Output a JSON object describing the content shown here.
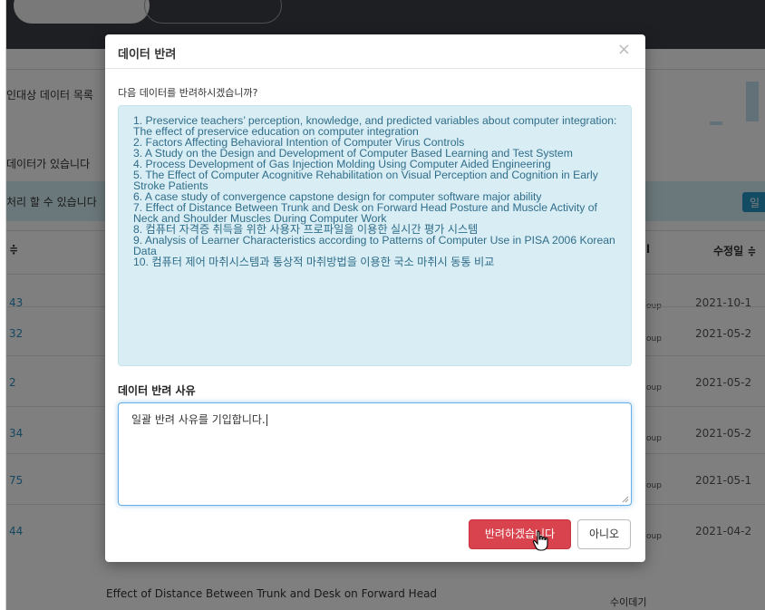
{
  "background": {
    "title_fragment": "인대상 데이터 목록",
    "notice_line1": "데이터가 있습니다",
    "notice_line2": "처리 할 수 있습니다",
    "button_fragment": "일",
    "col_head_left": "≑",
    "col_head_mid": "l",
    "col_head_right": "수정일 ≑",
    "rows": [
      {
        "id": "43",
        "group": "oup",
        "date": "2021-10-1"
      },
      {
        "id": "32",
        "group": "oup",
        "date": "2021-05-2"
      },
      {
        "id": "2",
        "group": "oup",
        "date": "2021-05-2"
      },
      {
        "id": "34",
        "group": "oup",
        "date": "2021-05-2"
      },
      {
        "id": "75",
        "group": "oup",
        "date": "2021-05-1"
      },
      {
        "id": "44",
        "group": "oup",
        "date": "2021-04-2"
      }
    ],
    "bottom_text": "Effect of Distance Between Trunk and Desk on Forward Head",
    "bottom_right": "수이데기"
  },
  "modal": {
    "title": "데이터 반려",
    "close": "×",
    "question": "다음 데이터를 반려하시겠습니까?",
    "items": [
      "1. Preservice teachers’ perception, knowledge, and predicted variables about computer integration: The effect of preservice education on computer integration",
      "2. Factors Affecting Behavioral Intention of Computer Virus Controls",
      "3. A Study on the Design and Development of Computer Based Learning and Test System",
      "4. Process Development of Gas Injection Molding Using Computer Aided Engineering",
      "5. The Effect of Computer Acognitive Rehabilitation on Visual Perception and Cognition in Early Stroke Patients",
      "6. A case study of convergence capstone design for computer software major ability",
      "7. Effect of Distance Between Trunk and Desk on Forward Head Posture and Muscle Activity of Neck and Shoulder Muscles During Computer Work",
      "8. 컴퓨터 자격증 취득을 위한 사용자 프로파일을 이용한 실시간 평가 시스템",
      "9. Analysis of Learner Characteristics according to Patterns of Computer Use in PISA 2006 Korean Data",
      "10. 컴퓨터 제어 마취시스템과 통상적 마취방법을 이용한 국소 마취시 동통 비교"
    ],
    "reason_label": "데이터 반려 사유",
    "reason_value": "일괄 반려 사유를 기입합니다.",
    "confirm_label": "반려하겠습니다",
    "no_label": "아니오"
  },
  "colors": {
    "danger": "#d9434e",
    "info_bg": "#d9edf4",
    "info_text": "#2f6d8a",
    "focus": "#66afe9"
  }
}
